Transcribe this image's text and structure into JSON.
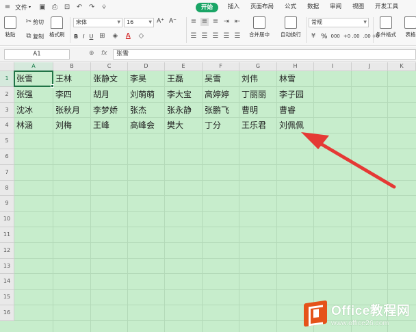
{
  "menubar": {
    "menu_icon": "hamburger-icon",
    "file_label": "文件",
    "quick_icons": [
      "save-icon",
      "print-icon",
      "print-preview-icon",
      "undo-icon",
      "redo-icon",
      "more-icon"
    ],
    "tabs": [
      {
        "label": "开始",
        "active": true
      },
      {
        "label": "插入",
        "active": false
      },
      {
        "label": "页面布局",
        "active": false
      },
      {
        "label": "公式",
        "active": false
      },
      {
        "label": "数据",
        "active": false
      },
      {
        "label": "审阅",
        "active": false
      },
      {
        "label": "视图",
        "active": false
      },
      {
        "label": "开发工具",
        "active": false
      }
    ],
    "active_color": "#1aa566"
  },
  "ribbon": {
    "paste_label": "粘贴",
    "cut_label": "剪切",
    "copy_label": "复制",
    "format_painter_label": "格式刷",
    "font_name": "宋体",
    "font_size": "16",
    "bold": "B",
    "italic": "I",
    "underline": "U",
    "font_grow": "A⁺",
    "font_shrink": "A⁻",
    "merge_label": "合并居中",
    "wrap_label": "自动换行",
    "number_format": "常规",
    "percent": "%",
    "thousands": "000",
    "inc_decimal": "+0 .00",
    "dec_decimal": ".00 +0",
    "cond_format_label": "条件格式",
    "table_style_label": "表格"
  },
  "formula_bar": {
    "cell_ref": "A1",
    "fx_label": "fx",
    "value": "张雪"
  },
  "sheet": {
    "columns": [
      "A",
      "B",
      "C",
      "D",
      "E",
      "F",
      "G",
      "H",
      "I",
      "J",
      "K"
    ],
    "rows": [
      "1",
      "2",
      "3",
      "4",
      "5",
      "6",
      "7",
      "8",
      "9",
      "10",
      "11",
      "12",
      "13",
      "14",
      "15",
      "16"
    ],
    "selected_cell": "A1",
    "data": [
      [
        "张雪",
        "王林",
        "张静文",
        "李昊",
        "王磊",
        "吴雪",
        "刘伟",
        "林雪"
      ],
      [
        "张强",
        "李四",
        "胡月",
        "刘萌萌",
        "李大宝",
        "高婷婷",
        "丁丽丽",
        "李子园"
      ],
      [
        "沈冰",
        "张秋月",
        "李梦娇",
        "张杰",
        "张永静",
        "张鹏飞",
        "曹明",
        "曹睿"
      ],
      [
        "林涵",
        "刘梅",
        "王峰",
        "高峰会",
        "樊大",
        "丁分",
        "王乐君",
        "刘佩佩"
      ]
    ],
    "grid_background": "#c7edcc",
    "selection_color": "#217346"
  },
  "annotation": {
    "arrow_color": "#e53935"
  },
  "watermark": {
    "title": "Office教程网",
    "url": "www.office26.com",
    "logo_color": "#e5531a"
  }
}
